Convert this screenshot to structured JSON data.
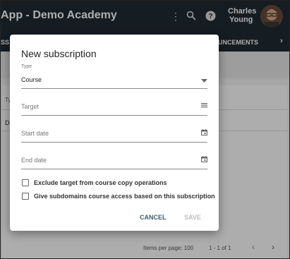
{
  "appbar": {
    "title": "App - Demo Academy",
    "user_first": "Charles",
    "user_last": "Young"
  },
  "tabs": {
    "left_partial": "SS",
    "right_partial": "UNCEMENTS"
  },
  "background": {
    "col_head": "Ty",
    "row_text": "Do",
    "items_per_page": "Items per page: 100",
    "range": "1 - 1 of 1"
  },
  "dialog": {
    "title": "New subscription",
    "type_label": "Type",
    "type_value": "Course",
    "target_placeholder": "Target",
    "start_placeholder": "Start date",
    "end_placeholder": "End date",
    "check1": "Exclude target from course copy operations",
    "check2": "Give subdomains course access based on this subscription",
    "cancel": "CANCEL",
    "save": "SAVE"
  },
  "colors": {
    "appbar": "#1f2a33",
    "cancel": "#3d5a6b",
    "save_disabled": "#bdbdbd"
  }
}
